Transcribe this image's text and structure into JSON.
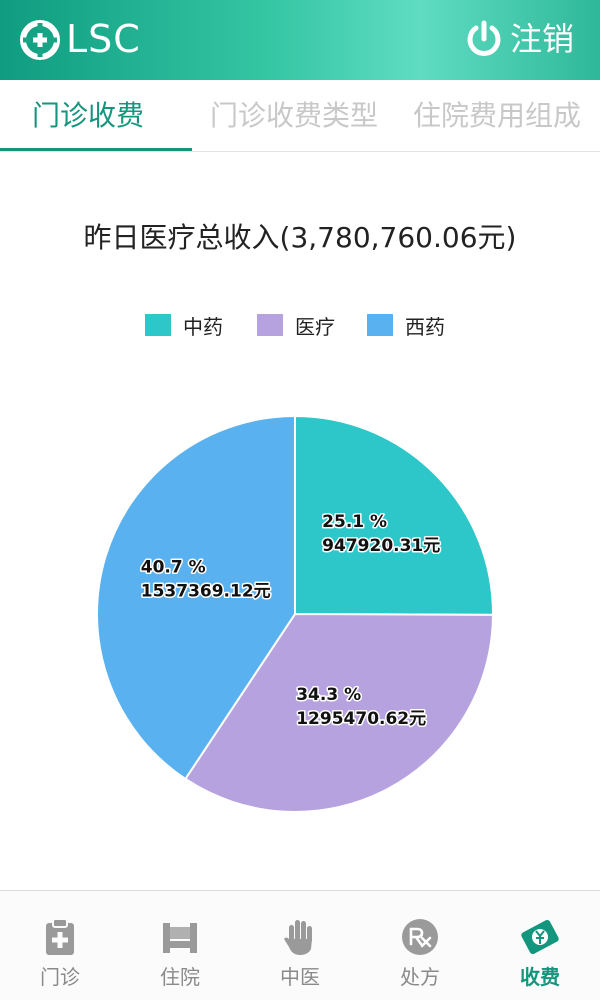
{
  "appbar": {
    "brand": "LSC",
    "logout_label": "注销"
  },
  "tabs": [
    {
      "label": "门诊收费",
      "active": true
    },
    {
      "label": "门诊收费类型",
      "active": false
    },
    {
      "label": "住院费用组成",
      "active": false
    }
  ],
  "chart_data": {
    "type": "pie",
    "title": "昨日医疗总收入(3,780,760.06元)",
    "legend_position": "top-center",
    "slices": [
      {
        "name": "中药",
        "percent_label": "25.1 %",
        "value_label": "947920.31元",
        "value": 947920.31,
        "color": "#2ec7c9"
      },
      {
        "name": "医疗",
        "percent_label": "34.3 %",
        "value_label": "1295470.62元",
        "value": 1295470.62,
        "color": "#b6a2de"
      },
      {
        "name": "西药",
        "percent_label": "40.7 %",
        "value_label": "1537369.12元",
        "value": 1537369.12,
        "color": "#5ab1ef"
      }
    ]
  },
  "bottom_nav": [
    {
      "label": "门诊",
      "icon": "clipboard-icon",
      "active": false
    },
    {
      "label": "住院",
      "icon": "bed-icon",
      "active": false
    },
    {
      "label": "中医",
      "icon": "hand-icon",
      "active": false
    },
    {
      "label": "处方",
      "icon": "rx-icon",
      "active": false
    },
    {
      "label": "收费",
      "icon": "money-icon",
      "active": true
    }
  ],
  "colors": {
    "accent": "#13967d",
    "inactive_tab": "#c8c8c8",
    "nav_inactive": "#8a8a8a"
  }
}
